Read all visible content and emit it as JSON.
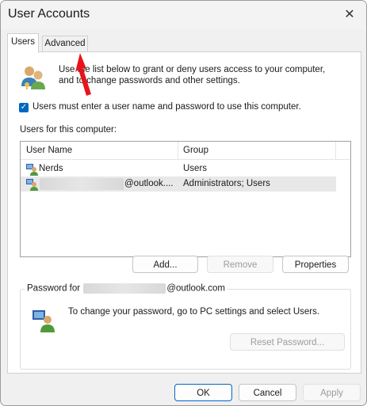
{
  "window": {
    "title": "User Accounts"
  },
  "tabs": [
    {
      "label": "Users"
    },
    {
      "label": "Advanced"
    }
  ],
  "info": {
    "text_line1": "Use the list below to grant or deny users access to your computer,",
    "text_line2": "and to change passwords and other settings."
  },
  "checkbox": {
    "label": "Users must enter a user name and password to use this computer.",
    "checked": true
  },
  "users_list": {
    "label": "Users for this computer:",
    "columns": [
      "User Name",
      "Group"
    ],
    "rows": [
      {
        "name": "Nerds",
        "group": "Users"
      },
      {
        "name": "@outlook....",
        "group": "Administrators; Users"
      }
    ]
  },
  "buttons": {
    "add": "Add...",
    "remove": "Remove",
    "properties": "Properties"
  },
  "password_group": {
    "legend_prefix": "Password for",
    "legend_suffix": "@outlook.com",
    "text": "To change your password, go to PC settings and select Users.",
    "reset_button": "Reset Password..."
  },
  "footer": {
    "ok": "OK",
    "cancel": "Cancel",
    "apply": "Apply"
  },
  "colors": {
    "accent": "#0067c0",
    "annotation_arrow": "#e8141c"
  }
}
